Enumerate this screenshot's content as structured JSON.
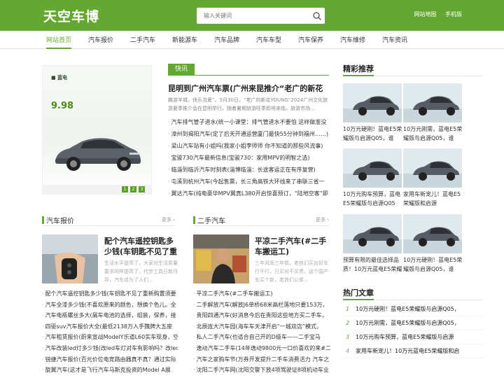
{
  "header": {
    "logo": "天空车博",
    "search_placeholder": "输入关键词",
    "links": [
      "网站地图",
      "手机版"
    ],
    "colors": {
      "brand": "#63a832"
    }
  },
  "nav": {
    "items": [
      "网站首页",
      "汽车报价",
      "二手汽车",
      "新能源车",
      "汽车品牌",
      "汽车车型",
      "汽车保养",
      "汽车维修",
      "汽车资讯"
    ],
    "active": "网站首页"
  },
  "slider": {
    "headline": "9.98",
    "pages": [
      "1",
      "2",
      "3"
    ]
  },
  "kuaixun": {
    "tag": "快讯",
    "headline": "昆明到广州汽车票(广州来昆推介“老广的新花",
    "summary": "趣游羊城，快乐当夏”。5月30日，“老广的新花YOUNG”2024广州文化旅游夏季推介会在昆明举行。随着暑期旅游旺季即将来临，旅游市场...",
    "items": [
      "汽车排气管子进水(统一小课堂：排气管进水不要怕 这样做准没",
      "漳州到揭阳汽车(定了后天开通运营厦门最快55分钟到福州……)",
      "梁山汽车站有小姐吗(我家小姐李师师 你不知道的那些风流事)",
      "宝骏730汽车最新信息(宝骏730：家用MPV的明智之选)",
      "临淄到临沂汽车时刻表(淄博临淄：长途客运正在有序复营)",
      "屯溪到杭州汽车(今起售票，长三角高铁大环线来了串联三省一",
      "翼达汽车(纯电豪华MPV翼真L380开启惊喜预订，“陆地空客”即"
    ]
  },
  "baojia": {
    "title": "汽车报价",
    "more": "更多",
    "feature_title": "配个汽车遥控钥匙多少钱(车钥匙不见了重新购",
    "feature_summary": "生活水平提高了，大家对生活质量要求同样提高了，代步工具日新月异，汽车成为了人们...",
    "items": [
      "配个汽车遥控钥匙多少钱(车钥匙不见了重新购置须要",
      "汽车全漆多少钱(不喜欢原来的颜色，想换个色儿。全",
      "汽车电瓶螺丝多大(屑车电池的选择，组装，保养，接",
      "四驱suv汽车报价大全(最低2138万入手魏牌大五座",
      "汽车租赁报价(蔚来宣战ModelY乐道L60实车现身，空",
      "汽车改装led灯多少钱(改led车灯对车有影响吗？改led",
      "锐捷汽车报价(百元价位电竞路由器真不真？通过实际",
      "旋翼汽车(这才是飞行汽车马斯克投资的Model A展"
    ]
  },
  "ershou": {
    "title": "二手汽车",
    "more": "更多",
    "feature_title": "平凉二手汽车(#二手车搬运工)",
    "feature_summary": "三年风雨三年情，老铁们买台好车行不行，只买对不买贵。这个国产车买个新，老铁们公爹...",
    "items": [
      "平凉二手汽车(#二手车搬运工)",
      "二手解放汽车(解放J6单桥68米高栏落地只要153万，",
      "贵阳四通汽车(好消息今后在贵阳这些地方买二手车，",
      "北辰庞大汽车园(海车车天津开启“一城双店”模式，",
      "私人二手汽车(也适合自己开的D级车——二手宝马",
      "逸动汽车二手车(14年逸动9800元一口价喜欢的来#二",
      "汽车之家购车节(万券开发提升二手车消费活力 汽车之",
      "沈阳二手汽车网(沈阳交警下放4项驾驶证8项机动车业"
    ]
  },
  "jingcai": {
    "title": "精彩推荐",
    "items": [
      "10万元硬刚！蓝电E5荣耀版与启源Q05，谁",
      "10万元刚需，蓝电E5荣耀版与启源Q05，谁",
      "10万元购车预算，蓝电E5荣耀版与启源Q05",
      "家用车新宠儿！蓝电E5荣耀版和启源",
      "预算有限的最佳选择品质！10万元蓝电E5荣耀",
      "10万元硬刚！蓝电E5荣耀版与启源Q05，谁"
    ]
  },
  "remen": {
    "title": "热门文章",
    "items": [
      {
        "num": "1",
        "text": "10万元硬刚！蓝电E5荣耀版与启源Q05，"
      },
      {
        "num": "2",
        "text": "10万元刚需，蓝电E5荣耀版与启源Q05，"
      },
      {
        "num": "3",
        "text": "10万元购车预算，蓝电E5荣耀版与启源"
      },
      {
        "num": "4",
        "text": "家用车新宠儿！10万元蓝电E5荣耀版和启"
      }
    ]
  }
}
